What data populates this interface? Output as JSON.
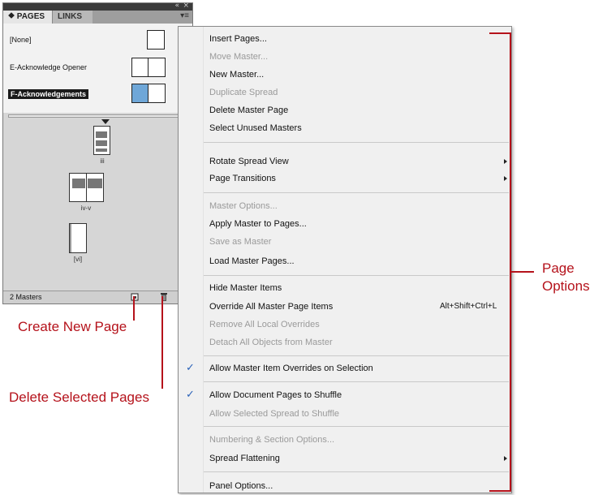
{
  "panel": {
    "controls": {
      "collapse": "«",
      "close": "×"
    },
    "tabs": [
      {
        "label": "⯁ PAGES",
        "active": true
      },
      {
        "label": "LINKS",
        "active": false
      }
    ],
    "menu_icon": "▾≡",
    "masters": [
      {
        "label": "[None]",
        "thumb": "single"
      },
      {
        "label": "E-Acknowledge Opener",
        "thumb": "spread"
      },
      {
        "label": "F-Acknowledgements",
        "thumb": "spread",
        "selected": true
      }
    ],
    "pages": [
      {
        "label": "iii"
      },
      {
        "label": "iv-v"
      },
      {
        "label": "[vi]"
      }
    ],
    "footer": {
      "count": "2 Masters",
      "new_page_icon": "new-page-icon",
      "delete_icon": "trash-icon"
    }
  },
  "menu": {
    "items": [
      {
        "label": "Insert Pages...",
        "enabled": true
      },
      {
        "label": "Move Master...",
        "enabled": false
      },
      {
        "label": "New Master...",
        "enabled": true
      },
      {
        "label": "Duplicate Spread",
        "enabled": false
      },
      {
        "label": "Delete Master Page",
        "enabled": true
      },
      {
        "label": "Select Unused Masters",
        "enabled": true
      },
      {
        "label": "Rotate Spread View",
        "enabled": true,
        "submenu": true
      },
      {
        "label": "Page Transitions",
        "enabled": true,
        "submenu": true
      },
      {
        "label": "Master Options...",
        "enabled": false
      },
      {
        "label": "Apply Master to Pages...",
        "enabled": true
      },
      {
        "label": "Save as Master",
        "enabled": false
      },
      {
        "label": "Load Master Pages...",
        "enabled": true
      },
      {
        "label": "Hide Master Items",
        "enabled": true
      },
      {
        "label": "Override All Master Page Items",
        "enabled": true,
        "shortcut": "Alt+Shift+Ctrl+L"
      },
      {
        "label": "Remove All Local Overrides",
        "enabled": false
      },
      {
        "label": "Detach All Objects from Master",
        "enabled": false
      },
      {
        "label": "Allow Master Item Overrides on Selection",
        "enabled": true,
        "checked": true
      },
      {
        "label": "Allow Document Pages to Shuffle",
        "enabled": true,
        "checked": true
      },
      {
        "label": "Allow Selected Spread to Shuffle",
        "enabled": false
      },
      {
        "label": "Numbering & Section Options...",
        "enabled": false
      },
      {
        "label": "Spread Flattening",
        "enabled": true,
        "submenu": true
      },
      {
        "label": "Panel Options...",
        "enabled": true
      }
    ],
    "check_mark": "✓"
  },
  "callouts": {
    "create_new_page": "Create New Page",
    "delete_selected_pages": "Delete Selected Pages",
    "page_options_line1": "Page",
    "page_options_line2": "Options"
  },
  "colors": {
    "callout_red": "#b5121b",
    "selection_blue": "#6fa7d8",
    "check_blue": "#2a62b8"
  }
}
